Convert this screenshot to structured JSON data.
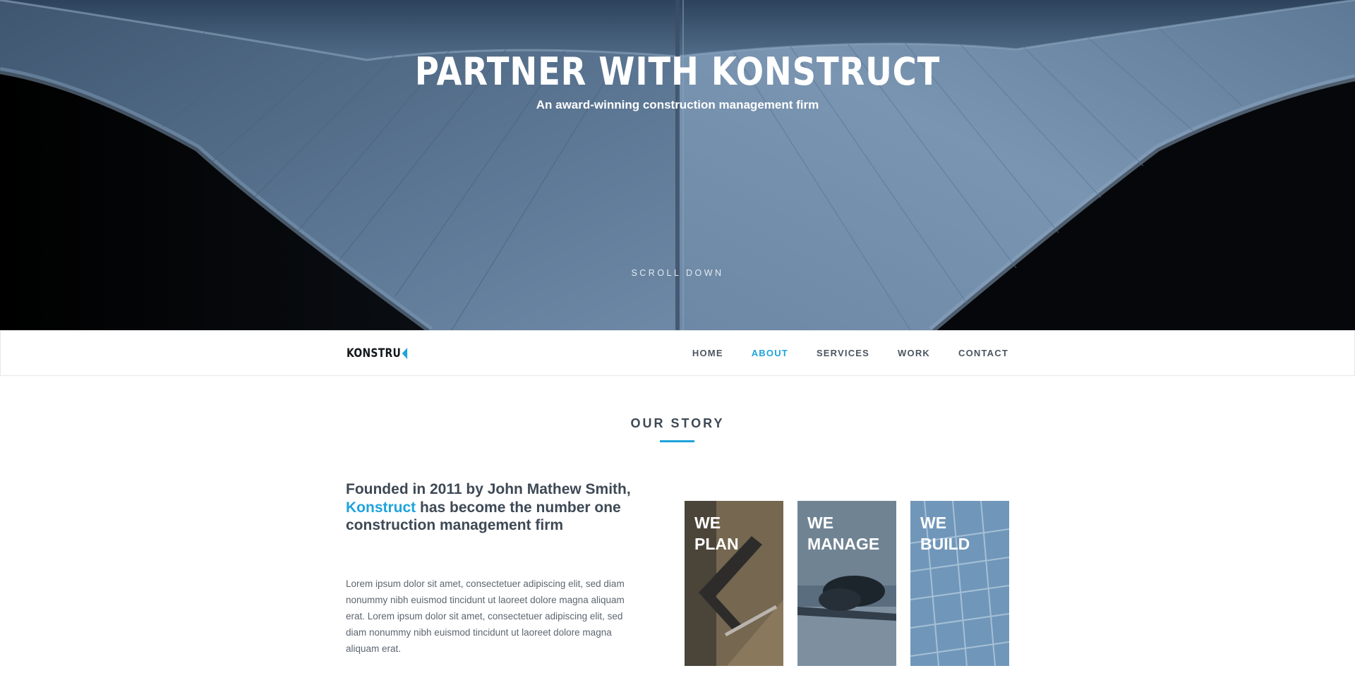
{
  "hero": {
    "title": "PARTNER WITH KONSTRUCT",
    "subtitle": "An award-winning construction management firm",
    "scroll_label": "SCROLL DOWN"
  },
  "nav": {
    "logo": "KONSTRU",
    "logo_mark_icon": "chevron-left-accent",
    "items": [
      {
        "label": "HOME",
        "active": false
      },
      {
        "label": "ABOUT",
        "active": true
      },
      {
        "label": "SERVICES",
        "active": false
      },
      {
        "label": "WORK",
        "active": false
      },
      {
        "label": "CONTACT",
        "active": false
      }
    ]
  },
  "story": {
    "section_title": "OUR STORY",
    "heading_before": "Founded in 2011 by John Mathew Smith, ",
    "heading_brand": "Konstruct",
    "heading_after": " has become the number one construction management firm",
    "body": "Lorem ipsum dolor sit amet, consectetuer adipiscing elit, sed diam nonummy nibh euismod tincidunt ut laoreet dolore magna aliquam erat. Lorem ipsum dolor sit amet, consectetuer adipiscing elit, sed diam nonummy nibh euismod tincidunt ut laoreet dolore magna aliquam erat.",
    "tiles": [
      {
        "label": "WE\nPLAN"
      },
      {
        "label": "WE\nMANAGE"
      },
      {
        "label": "WE\nBUILD"
      }
    ]
  },
  "colors": {
    "accent": "#1fa3dc",
    "text_dark": "#3e4955",
    "text_body": "#5c6670",
    "hero_steel": "#5f7a96"
  }
}
